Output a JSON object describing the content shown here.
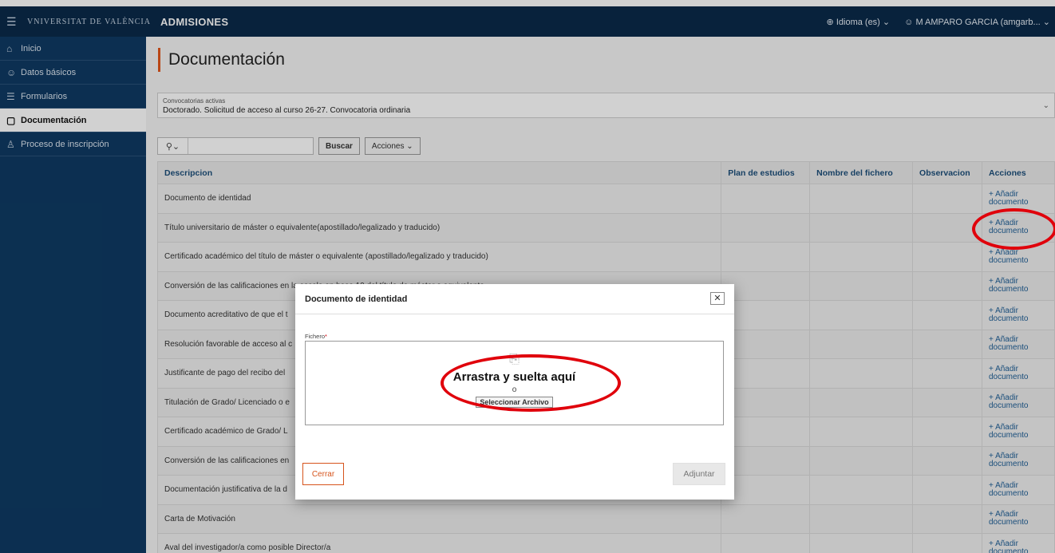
{
  "topbar": {
    "logo": "VNIVERSITAT DE VALÈNCIA",
    "title": "ADMISIONES",
    "language": "Idioma (es)",
    "user": "M AMPARO GARCIA (amgarb..."
  },
  "sidebar": {
    "items": [
      {
        "label": "Inicio",
        "icon": "home-icon"
      },
      {
        "label": "Datos básicos",
        "icon": "user-icon"
      },
      {
        "label": "Formularios",
        "icon": "form-icon"
      },
      {
        "label": "Documentación",
        "icon": "document-icon"
      },
      {
        "label": "Proceso de inscripción",
        "icon": "user-edit-icon"
      }
    ]
  },
  "main": {
    "title": "Documentación",
    "convocatoria": {
      "label": "Convocatorias activas",
      "value": "Doctorado. Solicitud de acceso al curso 26-27. Convocatoria ordinaria"
    },
    "toolbar": {
      "search_value": "",
      "buscar_label": "Buscar",
      "acciones_label": "Acciones"
    },
    "table": {
      "headers": [
        "Descripcion",
        "Plan de estudios",
        "Nombre del fichero",
        "Observacion",
        "Acciones"
      ],
      "action_label_1": "+ Añadir",
      "action_label_2": "documento",
      "rows": [
        "Documento de identidad",
        "Título universitario de máster o equivalente(apostillado/legalizado y traducido)",
        "Certificado académico del título de máster o equivalente (apostillado/legalizado y traducido)",
        "Conversión de las calificaciones en la escala en base 10 del título de máster o equivalente",
        "Documento acreditativo de que el t",
        "Resolución favorable de acceso al c",
        "Justificante de pago del recibo del",
        "Titulación de Grado/ Licenciado o e",
        "Certificado académico de Grado/ L",
        "Conversión de las calificaciones en",
        "Documentación justificativa de la d",
        "Carta de Motivación",
        "Aval del investigador/a como posible Director/a"
      ]
    }
  },
  "modal": {
    "title": "Documento de identidad",
    "field_label": "Fichero",
    "required_mark": "*",
    "drop_text": "Arrastra y suelta aquí",
    "or_text": "o",
    "select_button": "Seleccionar Archivo",
    "close_button": "Cerrar",
    "attach_button": "Adjuntar"
  },
  "colors": {
    "topbar": "#0a2a4a",
    "sidebar": "#0f3a63",
    "accent": "#e2561b",
    "link": "#1f5f96",
    "annotation": "#e0000b"
  }
}
